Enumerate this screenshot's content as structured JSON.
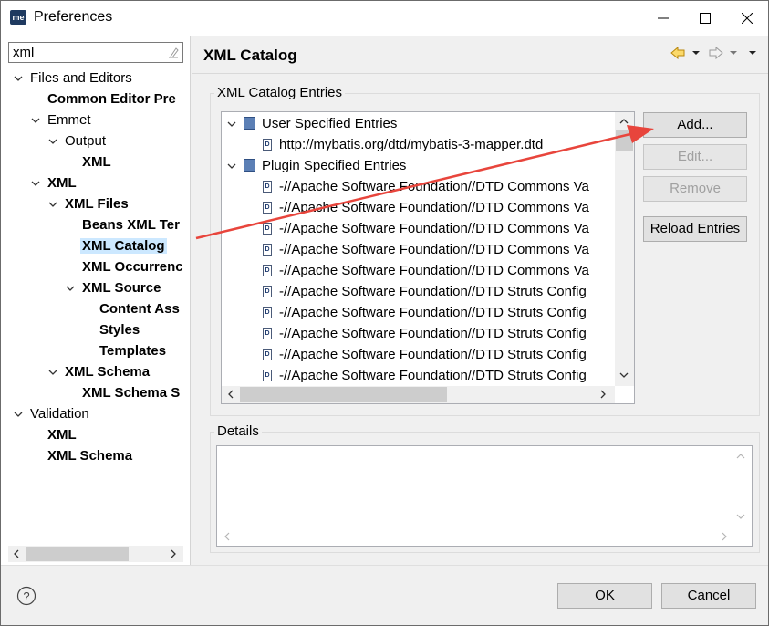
{
  "window": {
    "title": "Preferences",
    "app_icon_text": "me"
  },
  "filter": {
    "value": "xml"
  },
  "tree": {
    "files_and_editors": "Files and Editors",
    "common_editor": "Common Editor Pre",
    "emmet": "Emmet",
    "output": "Output",
    "output_xml": "XML",
    "xml": "XML",
    "xml_files": "XML Files",
    "beans_xml": "Beans XML Ter",
    "xml_catalog": "XML Catalog",
    "xml_occurrences": "XML Occurrenc",
    "xml_source": "XML Source",
    "content_assist": "Content Ass",
    "styles": "Styles",
    "templates": "Templates",
    "xml_schema": "XML Schema",
    "xml_schema_s": "XML Schema S",
    "validation": "Validation",
    "validation_xml": "XML",
    "validation_xml_schema": "XML Schema"
  },
  "page": {
    "title": "XML Catalog"
  },
  "catalog": {
    "group_label": "XML Catalog Entries",
    "user_specified": "User Specified Entries",
    "user_entries": [
      "http://mybatis.org/dtd/mybatis-3-mapper.dtd"
    ],
    "plugin_specified": "Plugin Specified Entries",
    "plugin_entries": [
      "-//Apache Software Foundation//DTD Commons Va",
      "-//Apache Software Foundation//DTD Commons Va",
      "-//Apache Software Foundation//DTD Commons Va",
      "-//Apache Software Foundation//DTD Commons Va",
      "-//Apache Software Foundation//DTD Commons Va",
      "-//Apache Software Foundation//DTD Struts Config",
      "-//Apache Software Foundation//DTD Struts Config",
      "-//Apache Software Foundation//DTD Struts Config",
      "-//Apache Software Foundation//DTD Struts Config",
      "-//Apache Software Foundation//DTD Struts Config"
    ]
  },
  "buttons": {
    "add": "Add...",
    "edit": "Edit...",
    "remove": "Remove",
    "reload": "Reload Entries",
    "ok": "OK",
    "cancel": "Cancel"
  },
  "details": {
    "group_label": "Details"
  },
  "colors": {
    "selection": "#cce8ff",
    "annotation_arrow": "#e8453c"
  }
}
